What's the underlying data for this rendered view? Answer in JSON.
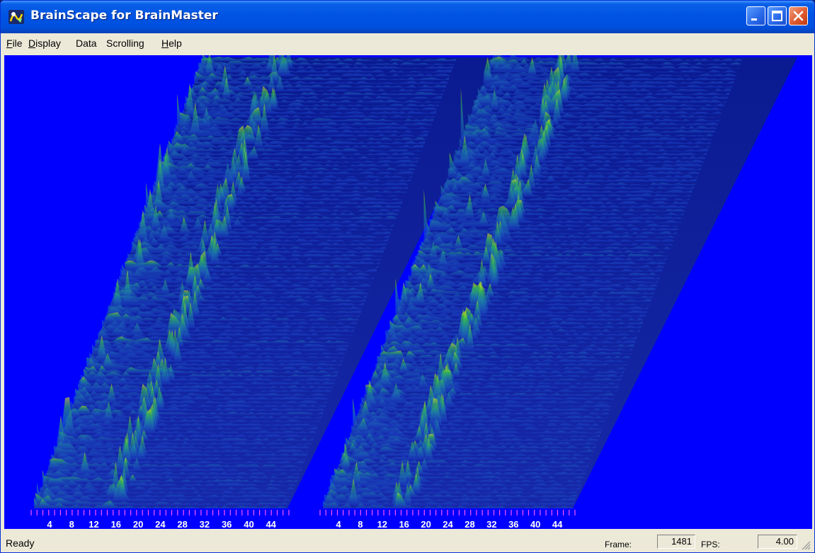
{
  "window": {
    "title": "BrainScape for BrainMaster",
    "controls": [
      "minimize",
      "maximize",
      "close"
    ],
    "title_color": "#ffffff"
  },
  "menu": {
    "items": [
      {
        "label": "File",
        "mnemonic": "F",
        "rest": "ile"
      },
      {
        "label": "Display",
        "mnemonic": "D",
        "rest": "isplay"
      },
      {
        "label": "Data",
        "mnemonic": "",
        "rest": "Data"
      },
      {
        "label": "Scrolling",
        "mnemonic": "",
        "rest": "Scrolling"
      },
      {
        "label": "Help",
        "mnemonic": "H",
        "rest": "elp"
      }
    ]
  },
  "spectrum": {
    "background_color": "#0000ff",
    "floor_color": "#00229a",
    "tick_color": "#ff55ff",
    "axis_label_color": "#ffffff",
    "panels": [
      {
        "name": "left",
        "axis_labels": [
          "4",
          "8",
          "12",
          "16",
          "20",
          "24",
          "28",
          "32",
          "36",
          "40",
          "44"
        ]
      },
      {
        "name": "right",
        "axis_labels": [
          "4",
          "8",
          "12",
          "16",
          "20",
          "24",
          "28",
          "32",
          "36",
          "40",
          "44"
        ]
      }
    ]
  },
  "status": {
    "text": "Ready",
    "frame_label": "Frame:",
    "frame_value": "1481",
    "fps_label": "FPS:",
    "fps_value": "4.00"
  }
}
